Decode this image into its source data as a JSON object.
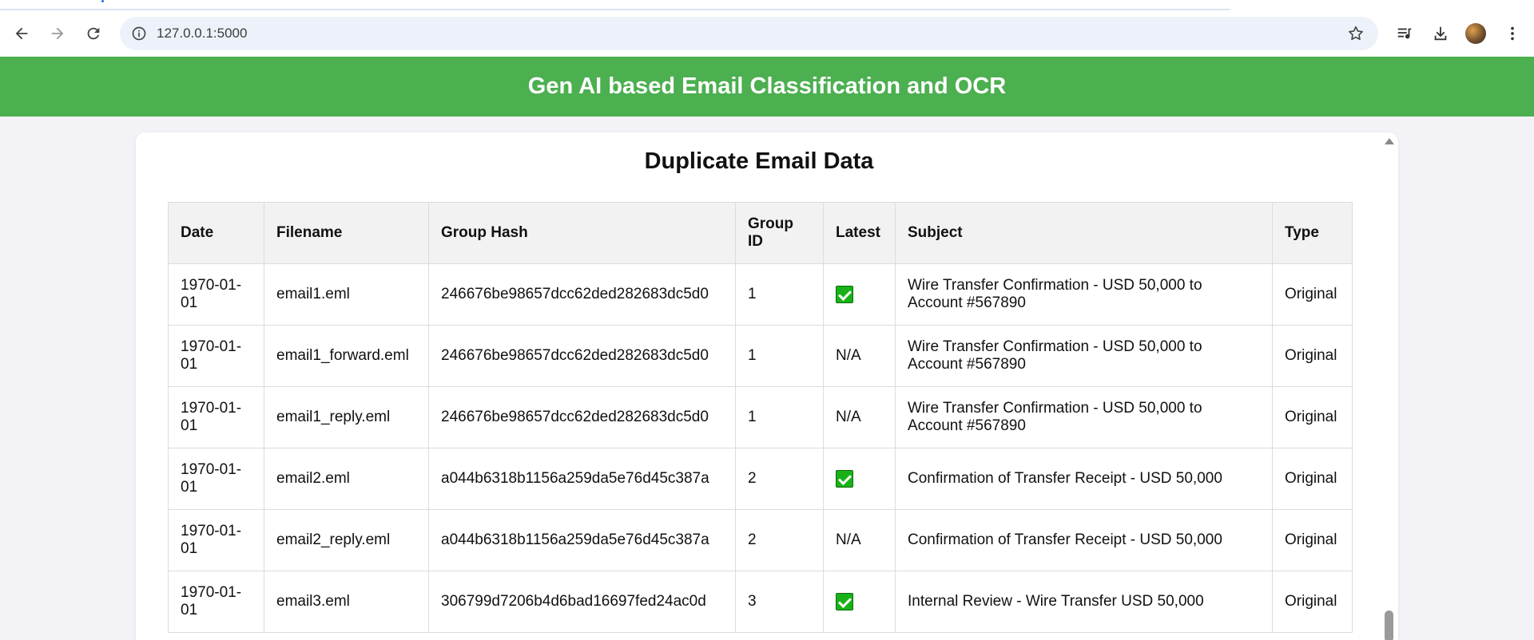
{
  "browser": {
    "url": "127.0.0.1:5000",
    "icons": {
      "back": "back-arrow-icon",
      "forward": "forward-arrow-icon",
      "reload": "reload-icon",
      "info": "site-info-icon",
      "bookmark": "star-icon",
      "media": "media-queue-icon",
      "download": "download-icon",
      "profile": "avatar",
      "menu": "kebab-menu-icon"
    }
  },
  "header": {
    "title": "Gen AI based Email Classification and OCR",
    "color": "#4caf50"
  },
  "main": {
    "title": "Duplicate Email Data",
    "columns": [
      "Date",
      "Filename",
      "Group Hash",
      "Group ID",
      "Latest",
      "Subject",
      "Type"
    ],
    "rows": [
      {
        "date": "1970-01-01",
        "filename": "email1.eml",
        "hash": "246676be98657dcc62ded282683dc5d0",
        "group_id": "1",
        "latest": true,
        "latest_text": "",
        "subject": "Wire Transfer Confirmation - USD 50,000 to Account #567890",
        "type": "Original"
      },
      {
        "date": "1970-01-01",
        "filename": "email1_forward.eml",
        "hash": "246676be98657dcc62ded282683dc5d0",
        "group_id": "1",
        "latest": false,
        "latest_text": "N/A",
        "subject": "Wire Transfer Confirmation - USD 50,000 to Account #567890",
        "type": "Original"
      },
      {
        "date": "1970-01-01",
        "filename": "email1_reply.eml",
        "hash": "246676be98657dcc62ded282683dc5d0",
        "group_id": "1",
        "latest": false,
        "latest_text": "N/A",
        "subject": "Wire Transfer Confirmation - USD 50,000 to Account #567890",
        "type": "Original"
      },
      {
        "date": "1970-01-01",
        "filename": "email2.eml",
        "hash": "a044b6318b1156a259da5e76d45c387a",
        "group_id": "2",
        "latest": true,
        "latest_text": "",
        "subject": "Confirmation of Transfer Receipt - USD 50,000",
        "type": "Original"
      },
      {
        "date": "1970-01-01",
        "filename": "email2_reply.eml",
        "hash": "a044b6318b1156a259da5e76d45c387a",
        "group_id": "2",
        "latest": false,
        "latest_text": "N/A",
        "subject": "Confirmation of Transfer Receipt - USD 50,000",
        "type": "Original"
      },
      {
        "date": "1970-01-01",
        "filename": "email3.eml",
        "hash": "306799d7206b4d6bad16697fed24ac0d",
        "group_id": "3",
        "latest": true,
        "latest_text": "",
        "subject": "Internal Review - Wire Transfer USD 50,000",
        "type": "Original"
      }
    ]
  }
}
